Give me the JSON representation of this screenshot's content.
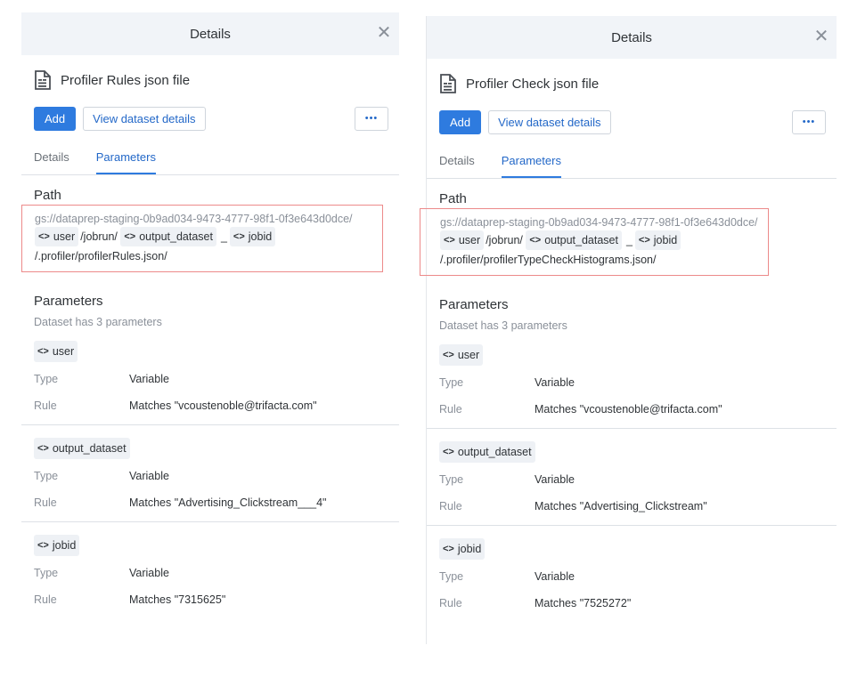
{
  "left": {
    "header_title": "Details",
    "file_name": "Profiler Rules json file",
    "add_label": "Add",
    "view_label": "View dataset details",
    "more_label": "•••",
    "tabs": [
      "Details",
      "Parameters"
    ],
    "path_title": "Path",
    "path_base": "gs://dataprep-staging-0b9ad034-9473-4777-98f1-0f3e643d0dce/",
    "path_tokens": {
      "user": "user",
      "mid": "/jobrun/",
      "output": "output_dataset",
      "sep": "_",
      "jobid": "jobid"
    },
    "path_tail": "/.profiler/profilerRules.json/",
    "params_title": "Parameters",
    "params_sub": "Dataset has 3 parameters",
    "params": [
      {
        "name": "user",
        "type_label": "Type",
        "type": "Variable",
        "rule_label": "Rule",
        "rule": "Matches \"vcoustenoble@trifacta.com\""
      },
      {
        "name": "output_dataset",
        "type_label": "Type",
        "type": "Variable",
        "rule_label": "Rule",
        "rule": "Matches \"Advertising_Clickstream___4\""
      },
      {
        "name": "jobid",
        "type_label": "Type",
        "type": "Variable",
        "rule_label": "Rule",
        "rule": "Matches \"7315625\""
      }
    ]
  },
  "right": {
    "header_title": "Details",
    "file_name": "Profiler Check json file",
    "add_label": "Add",
    "view_label": "View dataset details",
    "more_label": "•••",
    "tabs": [
      "Details",
      "Parameters"
    ],
    "path_title": "Path",
    "path_base": "gs://dataprep-staging-0b9ad034-9473-4777-98f1-0f3e643d0dce/",
    "path_tokens": {
      "user": "user",
      "mid": "/jobrun/",
      "output": "output_dataset",
      "sep": "_",
      "jobid": "jobid"
    },
    "path_tail": "/.profiler/profilerTypeCheckHistograms.json/",
    "params_title": "Parameters",
    "params_sub": "Dataset has 3 parameters",
    "params": [
      {
        "name": "user",
        "type_label": "Type",
        "type": "Variable",
        "rule_label": "Rule",
        "rule": "Matches \"vcoustenoble@trifacta.com\""
      },
      {
        "name": "output_dataset",
        "type_label": "Type",
        "type": "Variable",
        "rule_label": "Rule",
        "rule": "Matches \"Advertising_Clickstream\""
      },
      {
        "name": "jobid",
        "type_label": "Type",
        "type": "Variable",
        "rule_label": "Rule",
        "rule": "Matches \"7525272\""
      }
    ]
  },
  "icons": {
    "close": "close-icon",
    "file": "document-icon",
    "variable": "code-brackets-icon"
  },
  "colors": {
    "accent": "#2e7bdf",
    "highlight_box": "#ec8a8a",
    "header_bg": "#f1f4f8"
  }
}
